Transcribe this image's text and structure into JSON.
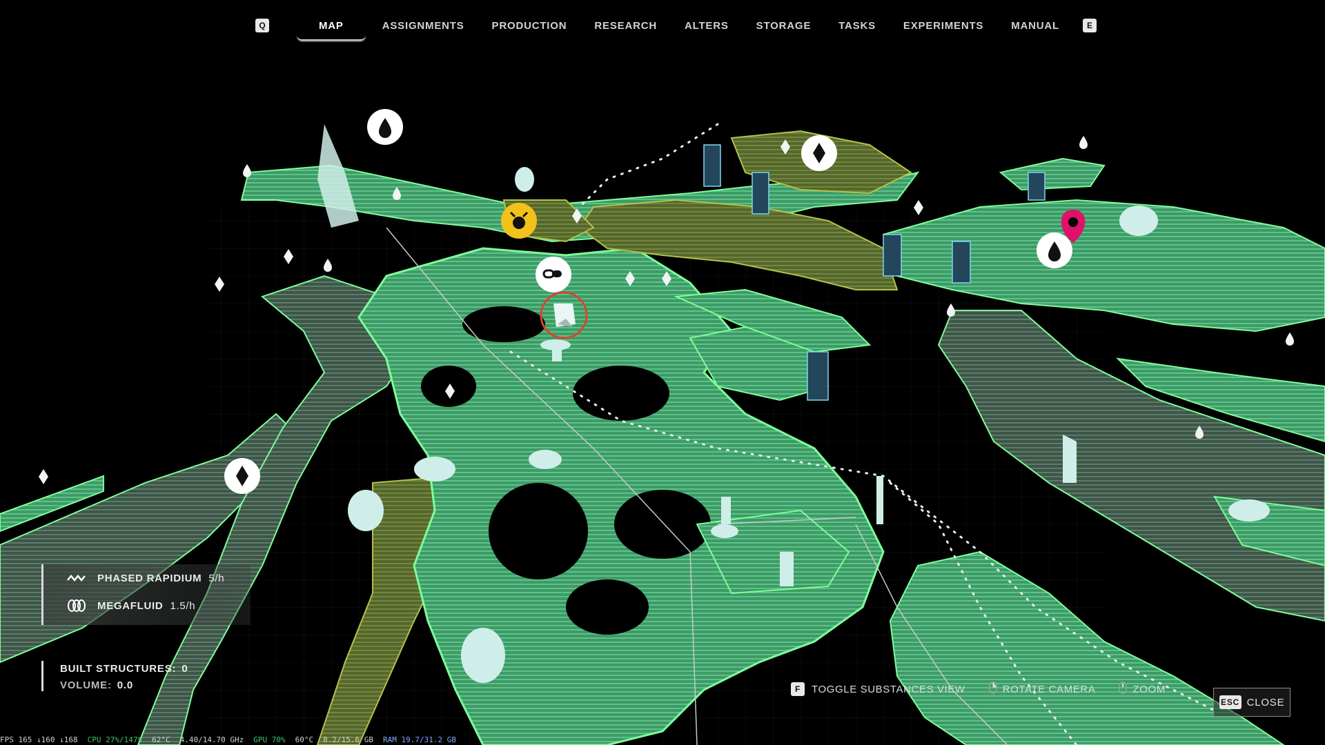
{
  "nav": {
    "left_key": "Q",
    "right_key": "E",
    "items": [
      {
        "label": "MAP",
        "active": true
      },
      {
        "label": "ASSIGNMENTS"
      },
      {
        "label": "PRODUCTION"
      },
      {
        "label": "RESEARCH"
      },
      {
        "label": "ALTERS"
      },
      {
        "label": "STORAGE"
      },
      {
        "label": "TASKS"
      },
      {
        "label": "EXPERIMENTS"
      },
      {
        "label": "MANUAL"
      }
    ]
  },
  "resources": [
    {
      "name": "PHASED RAPIDIUM",
      "rate": "5/h",
      "icon": "rapidium-wave-icon"
    },
    {
      "name": "MEGAFLUID",
      "rate": "1.5/h",
      "icon": "megafluid-icon"
    }
  ],
  "stats": {
    "built_label": "BUILT STRUCTURES:",
    "built_value": "0",
    "volume_label": "VOLUME:",
    "volume_value": "0.0"
  },
  "hints": {
    "toggle_key": "F",
    "toggle_label": "TOGGLE SUBSTANCES VIEW",
    "rotate_label": "ROTATE CAMERA",
    "zoom_label": "ZOOM",
    "close_key": "ESC",
    "close_label": "CLOSE"
  },
  "perf": {
    "fps": "FPS 165 ↓160 ↓168",
    "cpu": "CPU 27%/147%",
    "cpu_temp": "62°C",
    "cpu_freq": "4.40/14.70 GHz",
    "gpu": "GPU 70%",
    "gpu_temp": "60°C",
    "vram": "8.2/15.6 GB",
    "ram": "RAM 19.7/31.2 GB"
  },
  "colors": {
    "terrain_green": "#4fb57a",
    "terrain_edge": "#7dff9a",
    "terrain_olive": "#7a8f3a",
    "marker_yellow": "#f2c21a",
    "marker_pink": "#e0116a",
    "player_ring": "#d9452f"
  }
}
